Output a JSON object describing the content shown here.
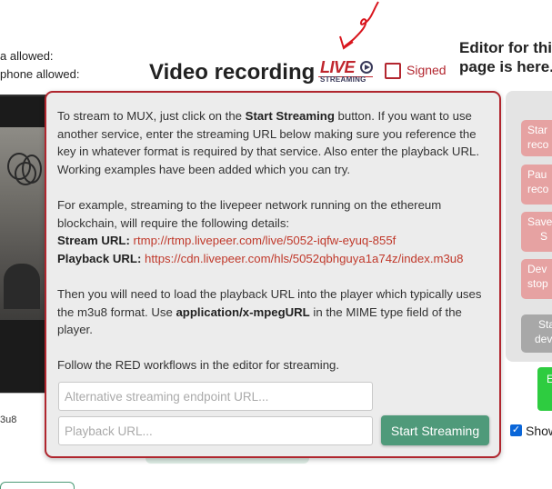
{
  "permissions": {
    "camera_line": "a allowed:",
    "microphone_line": "phone allowed:"
  },
  "header": {
    "title": "Video recording",
    "live_logo_main": "LIVE",
    "live_logo_sub": "STREAMING",
    "signed_label": "Signed",
    "editor_note_line1": "Editor for this",
    "editor_note_line2": "page is here."
  },
  "left_column": {
    "codec_stub": "3u8"
  },
  "controls": {
    "start_recording": [
      "Star",
      "reco"
    ],
    "pause_recording": [
      "Pau",
      "reco"
    ],
    "save": [
      "Save",
      "S"
    ],
    "device_stop": [
      "Dev",
      "stop"
    ],
    "start_device": [
      "Sta",
      "dev"
    ],
    "green_button": "E",
    "show_label": "Show"
  },
  "popup": {
    "intro_pre": "To stream to MUX, just click on the ",
    "intro_bold": "Start Streaming",
    "intro_post": " button. If you want to use another service, enter the streaming URL below making sure you reference the key in whatever format is required by that service. Also enter the playback URL. Working examples have been added which you can try.",
    "example_intro": "For example, streaming to the livepeer network running on the ethereum blockchain, will require the following details:",
    "stream_url_label": "Stream URL:",
    "stream_url_value": "rtmp://rtmp.livepeer.com/live/5052-iqfw-eyuq-855f",
    "playback_url_label": "Playback URL:",
    "playback_url_value": "https://cdn.livepeer.com/hls/5052qbhguya1a74z/index.m3u8",
    "player_pre": "Then you will need to load the playback URL into the player which typically uses the m3u8 format. Use ",
    "player_bold": "application/x-mpegURL",
    "player_post": " in the MIME type field of the player.",
    "follow_note": "Follow the RED workflows in the editor for streaming.",
    "alt_endpoint_placeholder": "Alternative streaming endpoint URL...",
    "playback_placeholder": "Playback URL...",
    "start_button": "Start Streaming"
  },
  "colors": {
    "accent_red": "#b0262e",
    "start_button": "#4f9a7a",
    "control_button": "#e6a2a2"
  }
}
